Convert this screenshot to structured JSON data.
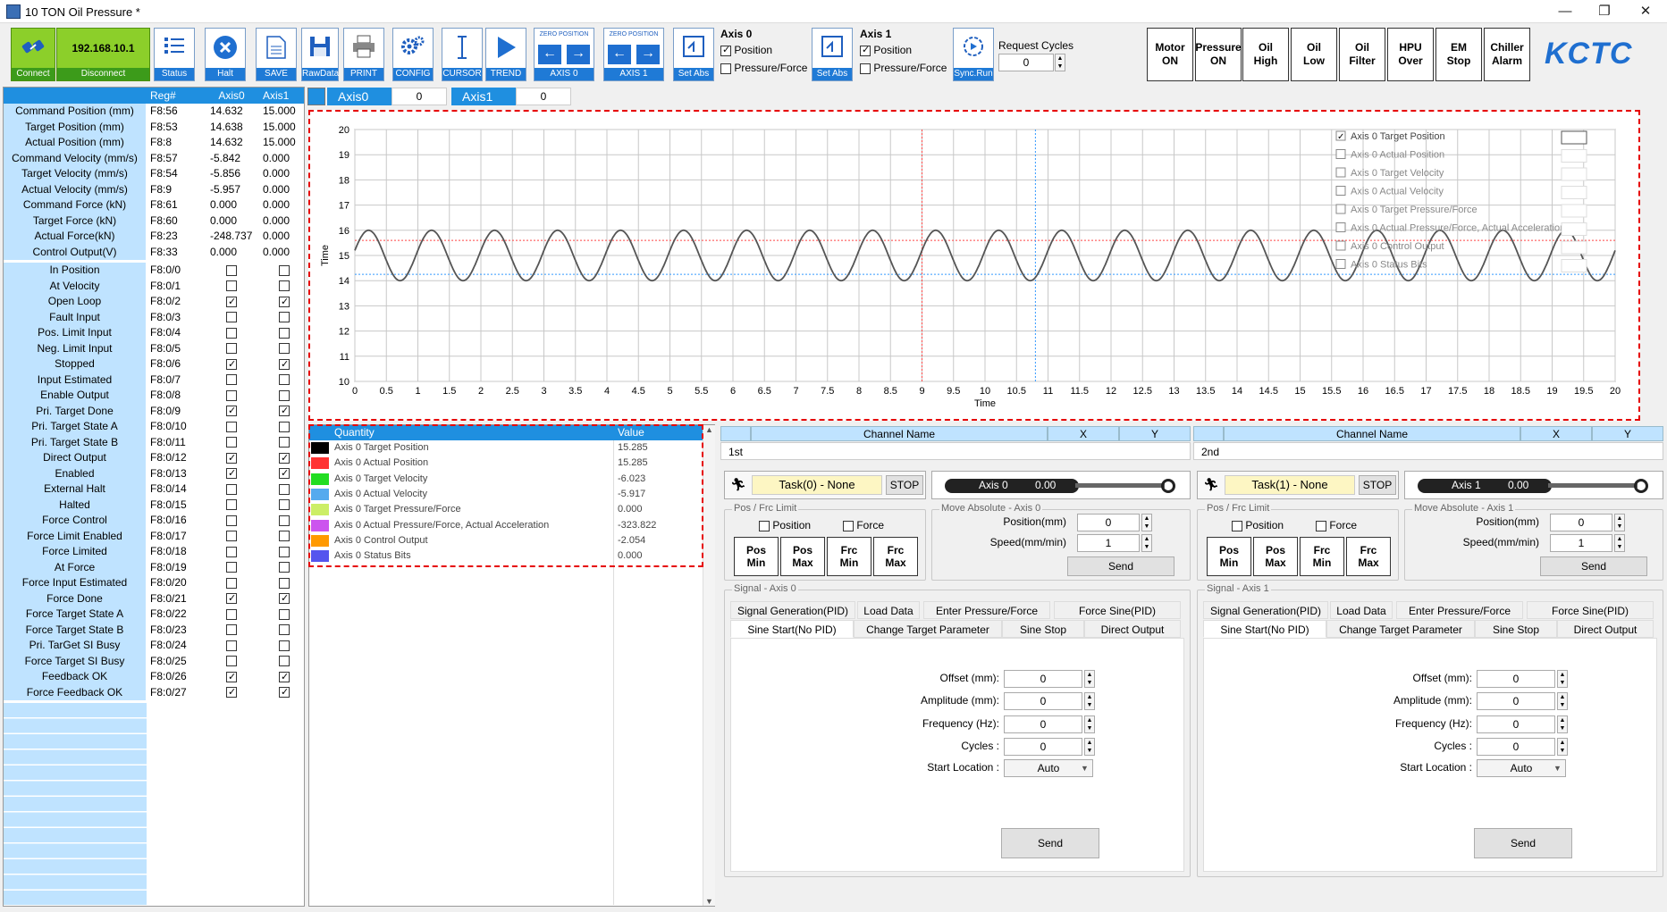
{
  "window": {
    "title": "10 TON Oil Pressure *",
    "minimize": "—",
    "maximize": "❐",
    "close": "✕"
  },
  "toolbar": {
    "ip": "192.168.10.1",
    "connect": "Connect",
    "disconnect": "Disconnect",
    "status": "Status",
    "halt": "Halt",
    "save": "SAVE",
    "rawdata": "RawData",
    "print": "PRINT",
    "config": "CONFIG",
    "cursor": "CURSOR",
    "trend": "TREND",
    "axis0": "AXIS 0",
    "axis1": "AXIS 1",
    "zero_position": "ZERO POSITION",
    "set_abs": "Set Abs",
    "sync_run": "Sync.Run",
    "axis0_label": "Axis 0",
    "axis1_label": "Axis 1",
    "position": "Position",
    "pressure_force": "Pressure/Force",
    "request_cycles_label": "Request Cycles",
    "request_cycles_value": "0"
  },
  "status_buttons": [
    {
      "l1": "Motor",
      "l2": "ON"
    },
    {
      "l1": "Pressure",
      "l2": "ON"
    },
    {
      "l1": "Oil",
      "l2": "High"
    },
    {
      "l1": "Oil",
      "l2": "Low"
    },
    {
      "l1": "Oil",
      "l2": "Filter"
    },
    {
      "l1": "HPU",
      "l2": "Over"
    },
    {
      "l1": "EM",
      "l2": "Stop"
    },
    {
      "l1": "Chiller",
      "l2": "Alarm"
    }
  ],
  "logo": "KCTC",
  "left_table": {
    "headers": [
      "",
      "Reg#",
      "Axis0",
      "Axis1"
    ],
    "values": [
      [
        "Command Position (mm)",
        "F8:56",
        "14.632",
        "15.000"
      ],
      [
        "Target Position (mm)",
        "F8:53",
        "14.638",
        "15.000"
      ],
      [
        "Actual Position (mm)",
        "F8:8",
        "14.632",
        "15.000"
      ],
      [
        "Command Velocity (mm/s)",
        "F8:57",
        "-5.842",
        "0.000"
      ],
      [
        "Target Velocity (mm/s)",
        "F8:54",
        "-5.856",
        "0.000"
      ],
      [
        "Actual Velocity (mm/s)",
        "F8:9",
        "-5.957",
        "0.000"
      ],
      [
        "Command Force (kN)",
        "F8:61",
        "0.000",
        "0.000"
      ],
      [
        "Target Force (kN)",
        "F8:60",
        "0.000",
        "0.000"
      ],
      [
        "Actual Force(kN)",
        "F8:23",
        "-248.737",
        "0.000"
      ],
      [
        "Control Output(V)",
        "F8:33",
        "0.000",
        "0.000"
      ]
    ],
    "flags": [
      [
        "In Position",
        "F8:0/0",
        false,
        false
      ],
      [
        "At Velocity",
        "F8:0/1",
        false,
        false
      ],
      [
        "Open Loop",
        "F8:0/2",
        true,
        true
      ],
      [
        "Fault Input",
        "F8:0/3",
        false,
        false
      ],
      [
        "Pos. Limit Input",
        "F8:0/4",
        false,
        false
      ],
      [
        "Neg. Limit Input",
        "F8:0/5",
        false,
        false
      ],
      [
        "Stopped",
        "F8:0/6",
        true,
        true
      ],
      [
        "Input Estimated",
        "F8:0/7",
        false,
        false
      ],
      [
        "Enable Output",
        "F8:0/8",
        false,
        false
      ],
      [
        "Pri. Target Done",
        "F8:0/9",
        true,
        true
      ],
      [
        "Pri. Target State A",
        "F8:0/10",
        false,
        false
      ],
      [
        "Pri. Target State B",
        "F8:0/11",
        false,
        false
      ],
      [
        "Direct Output",
        "F8:0/12",
        true,
        true
      ],
      [
        "Enabled",
        "F8:0/13",
        true,
        true
      ],
      [
        "External Halt",
        "F8:0/14",
        false,
        false
      ],
      [
        "Halted",
        "F8:0/15",
        false,
        false
      ],
      [
        "Force Control",
        "F8:0/16",
        false,
        false
      ],
      [
        "Force Limit Enabled",
        "F8:0/17",
        false,
        false
      ],
      [
        "Force Limited",
        "F8:0/18",
        false,
        false
      ],
      [
        "At Force",
        "F8:0/19",
        false,
        false
      ],
      [
        "Force Input Estimated",
        "F8:0/20",
        false,
        false
      ],
      [
        "Force Done",
        "F8:0/21",
        true,
        true
      ],
      [
        "Force Target State A",
        "F8:0/22",
        false,
        false
      ],
      [
        "Force Target State B",
        "F8:0/23",
        false,
        false
      ],
      [
        "Pri. TarGet SI Busy",
        "F8:0/24",
        false,
        false
      ],
      [
        "Force Target SI Busy",
        "F8:0/25",
        false,
        false
      ],
      [
        "Feedback OK",
        "F8:0/26",
        true,
        true
      ],
      [
        "Force Feedback OK",
        "F8:0/27",
        true,
        true
      ]
    ]
  },
  "axis_tabs": [
    {
      "name": "Axis0",
      "value": "0"
    },
    {
      "name": "Axis1",
      "value": "0"
    }
  ],
  "chart_data": {
    "type": "line",
    "xlabel": "Time",
    "ylabel": "Time",
    "xlim": [
      0,
      20
    ],
    "ylim": [
      10,
      20
    ],
    "xticks": [
      "0",
      "0.5",
      "1",
      "1.5",
      "2",
      "2.5",
      "3",
      "3.5",
      "4",
      "4.5",
      "5",
      "5.5",
      "6",
      "6.5",
      "7",
      "7.5",
      "8",
      "8.5",
      "9",
      "9.5",
      "10",
      "10.5",
      "11",
      "11.5",
      "12",
      "12.5",
      "13",
      "13.5",
      "14",
      "14.5",
      "15",
      "15.5",
      "16",
      "16.5",
      "17",
      "17.5",
      "18",
      "18.5",
      "19",
      "19.5",
      "20"
    ],
    "yticks": [
      "10",
      "11",
      "12",
      "13",
      "14",
      "15",
      "16",
      "17",
      "18",
      "19",
      "20"
    ],
    "series": [
      {
        "name": "Axis 0 Target Position",
        "sine": {
          "offset": 15,
          "amplitude": 1,
          "period": 1
        },
        "color": "#555555",
        "checked": true
      }
    ],
    "legend": [
      {
        "name": "Axis 0 Target Position",
        "checked": true
      },
      {
        "name": "Axis 0 Actual Position",
        "checked": false
      },
      {
        "name": "Axis 0 Target Velocity",
        "checked": false
      },
      {
        "name": "Axis 0 Actual Velocity",
        "checked": false
      },
      {
        "name": "Axis 0 Target Pressure/Force",
        "checked": false
      },
      {
        "name": "Axis 0 Actual Pressure/Force, Actual Acceleration",
        "checked": false
      },
      {
        "name": "Axis 0 Control Output",
        "checked": false
      },
      {
        "name": "Axis 0 Status Bits",
        "checked": false
      }
    ],
    "ref_lines": {
      "red_h": 15.6,
      "blue_h": 14.25,
      "red_v": 9,
      "blue_v": 10.8
    }
  },
  "quantity_table": {
    "headers": [
      "Quantity",
      "Value"
    ],
    "rows": [
      {
        "name": "Axis 0 Target Position",
        "value": "15.285",
        "color": "#000000"
      },
      {
        "name": "Axis 0 Actual Position",
        "value": "15.285",
        "color": "#ff3333"
      },
      {
        "name": "Axis 0 Target Velocity",
        "value": "-6.023",
        "color": "#22dd22"
      },
      {
        "name": "Axis 0 Actual Velocity",
        "value": "-5.917",
        "color": "#55aaee"
      },
      {
        "name": "Axis 0 Target Pressure/Force",
        "value": "0.000",
        "color": "#ccee66"
      },
      {
        "name": "Axis 0 Actual Pressure/Force, Actual Acceleration",
        "value": "-323.822",
        "color": "#cc55ee"
      },
      {
        "name": "Axis 0 Control Output",
        "value": "-2.054",
        "color": "#ff9900"
      },
      {
        "name": "Axis 0 Status Bits",
        "value": "0.000",
        "color": "#5555ee"
      }
    ]
  },
  "panels": [
    {
      "channel_label": "1st",
      "channel_headers": [
        "Channel Name",
        "X",
        "Y"
      ],
      "task": "Task(0) - None",
      "stop": "STOP",
      "cyl_label": "Axis 0",
      "cyl_value": "0.00",
      "limit_title": "Pos / Frc Limit",
      "limit_pos": "Position",
      "limit_force": "Force",
      "limit_btns": [
        {
          "l1": "Pos",
          "l2": "Min"
        },
        {
          "l1": "Pos",
          "l2": "Max"
        },
        {
          "l1": "Frc",
          "l2": "Min"
        },
        {
          "l1": "Frc",
          "l2": "Max"
        }
      ],
      "move_title": "Move Absolute - Axis 0",
      "pos_label": "Position(mm)",
      "pos_value": "0",
      "speed_label": "Speed(mm/min)",
      "speed_value": "1",
      "send": "Send",
      "signal_title": "Signal - Axis 0",
      "tabs_row1": [
        "Signal Generation(PID)",
        "Load Data",
        "Enter Pressure/Force",
        "Force Sine(PID)"
      ],
      "tabs_row2": [
        "Sine Start(No PID)",
        "Change Target Parameter",
        "Sine Stop",
        "Direct Output"
      ],
      "offset_label": "Offset (mm):",
      "offset_value": "0",
      "amp_label": "Amplitude (mm):",
      "amp_value": "0",
      "freq_label": "Frequency (Hz):",
      "freq_value": "0",
      "cycles_label": "Cycles :",
      "cycles_value": "0",
      "start_label": "Start Location :",
      "start_value": "Auto",
      "send2": "Send"
    },
    {
      "channel_label": "2nd",
      "channel_headers": [
        "Channel Name",
        "X",
        "Y"
      ],
      "task": "Task(1) - None",
      "stop": "STOP",
      "cyl_label": "Axis 1",
      "cyl_value": "0.00",
      "limit_title": "Pos / Frc Limit",
      "limit_pos": "Position",
      "limit_force": "Force",
      "limit_btns": [
        {
          "l1": "Pos",
          "l2": "Min"
        },
        {
          "l1": "Pos",
          "l2": "Max"
        },
        {
          "l1": "Frc",
          "l2": "Min"
        },
        {
          "l1": "Frc",
          "l2": "Max"
        }
      ],
      "move_title": "Move Absolute - Axis 1",
      "pos_label": "Position(mm)",
      "pos_value": "0",
      "speed_label": "Speed(mm/min)",
      "speed_value": "1",
      "send": "Send",
      "signal_title": "Signal - Axis 1",
      "tabs_row1": [
        "Signal Generation(PID)",
        "Load Data",
        "Enter Pressure/Force",
        "Force Sine(PID)"
      ],
      "tabs_row2": [
        "Sine Start(No PID)",
        "Change Target Parameter",
        "Sine Stop",
        "Direct Output"
      ],
      "offset_label": "Offset (mm):",
      "offset_value": "0",
      "amp_label": "Amplitude (mm):",
      "amp_value": "0",
      "freq_label": "Frequency (Hz):",
      "freq_value": "0",
      "cycles_label": "Cycles :",
      "cycles_value": "0",
      "start_label": "Start Location :",
      "start_value": "Auto",
      "send2": "Send"
    }
  ]
}
